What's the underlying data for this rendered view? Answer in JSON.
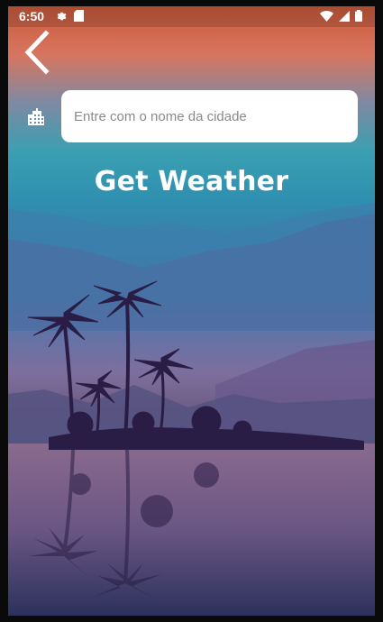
{
  "status_bar": {
    "time": "6:50",
    "left_icons": [
      "gear-icon",
      "sim-card-icon"
    ],
    "right_icons": [
      "wifi-icon",
      "signal-icon",
      "battery-icon"
    ]
  },
  "toolbar": {
    "back_icon": "chevron-left-icon"
  },
  "search": {
    "leading_icon": "city-buildings-icon",
    "value": "",
    "placeholder": "Entre com o nome da cidade"
  },
  "action": {
    "label": "Get Weather"
  },
  "colors": {
    "sky_top": "#c95a3c",
    "sky_mid": "#2f8fb0",
    "silhouette": "#2a1d45",
    "text": "#ffffff"
  }
}
